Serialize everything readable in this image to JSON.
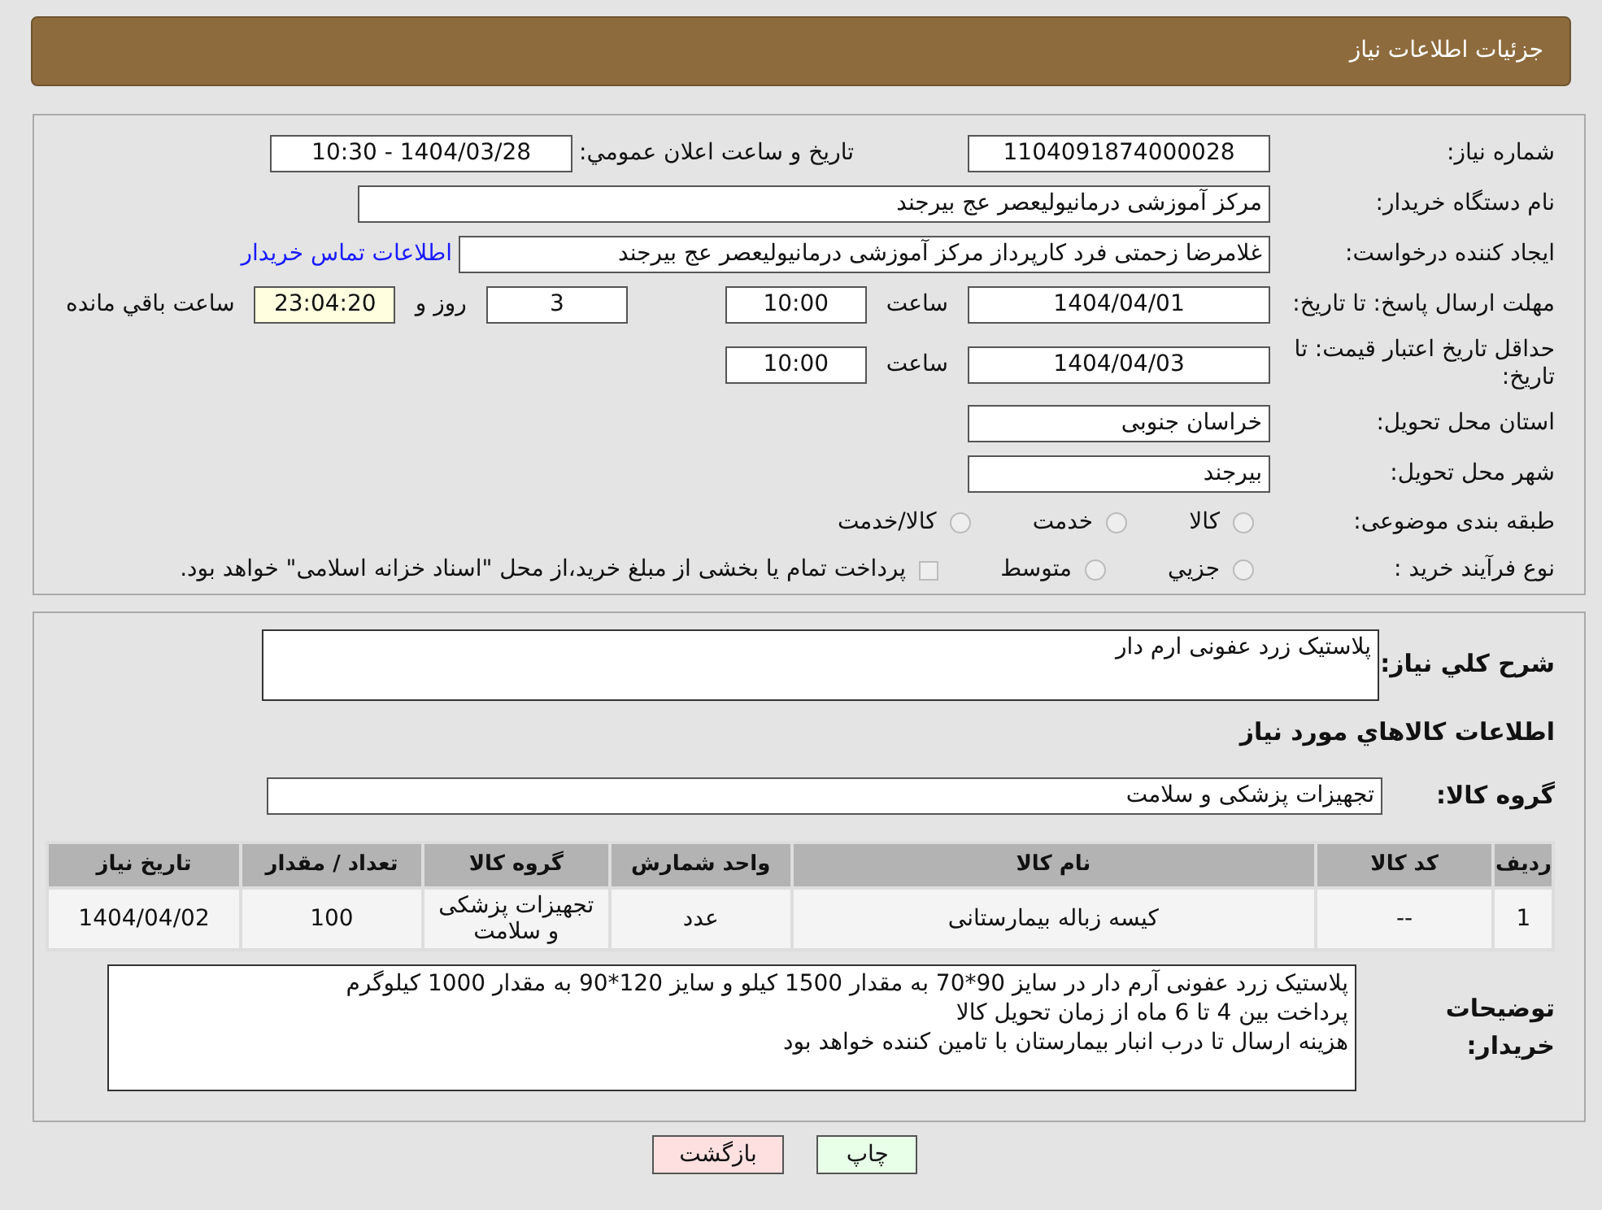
{
  "header": {
    "title": "جزئیات اطلاعات نیاز"
  },
  "need_number": {
    "label": "شماره نیاز:",
    "value": "1104091874000028"
  },
  "announce": {
    "label": "تاریخ و ساعت اعلان عمومي:",
    "value": "1404/03/28 - 10:30"
  },
  "buyer_org": {
    "label": "نام دستگاه خریدار:",
    "value": "مرکز آموزشی درمانیولیعصر  عج  بیرجند"
  },
  "requester": {
    "label": "ایجاد کننده درخواست:",
    "value": "غلامرضا زحمتی فرد کارپرداز مرکز آموزشی درمانیولیعصر  عج  بیرجند",
    "link": "اطلاعات تماس خریدار"
  },
  "reply_deadline": {
    "label": "مهلت ارسال پاسخ: تا تاریخ:",
    "date": "1404/04/01",
    "time_label": "ساعت",
    "time": "10:00",
    "days": "3",
    "days_label": "روز و",
    "remaining": "23:04:20",
    "remaining_label": "ساعت باقي مانده"
  },
  "price_validity": {
    "label": "حداقل تاریخ اعتبار قیمت: تا تاریخ:",
    "date": "1404/04/03",
    "time_label": "ساعت",
    "time": "10:00"
  },
  "province": {
    "label": "استان محل تحویل:",
    "value": "خراسان جنوبی"
  },
  "city": {
    "label": "شهر محل تحویل:",
    "value": "بیرجند"
  },
  "category": {
    "label": "طبقه بندی موضوعی:",
    "options": [
      {
        "label": "کالا",
        "selected": false
      },
      {
        "label": "خدمت",
        "selected": false
      },
      {
        "label": "کالا/خدمت",
        "selected": false
      }
    ]
  },
  "purchase_type": {
    "label": "نوع فرآیند خرید :",
    "options": [
      {
        "label": "جزيي",
        "selected": false
      },
      {
        "label": "متوسط",
        "selected": false
      }
    ],
    "note": {
      "text": "پرداخت تمام یا بخشی از مبلغ خرید،از محل \"اسناد خزانه اسلامی\" خواهد بود.",
      "checked": false
    }
  },
  "description": {
    "label": "شرح کلي نیاز:",
    "value": "پلاستیک زرد عفونی ارم دار"
  },
  "goods_heading": "اطلاعات کالاهاي مورد نیاز",
  "goods_group": {
    "label": "گروه کالا:",
    "value": "تجهیزات پزشکی و سلامت"
  },
  "table": {
    "columns": [
      "ردیف",
      "کد کالا",
      "نام کالا",
      "واحد شمارش",
      "گروه کالا",
      "تعداد / مقدار",
      "تاریخ نیاز"
    ],
    "rows": [
      [
        "1",
        "--",
        "کیسه زباله بیمارستانی",
        "عدد",
        "تجهیزات پزشکی و سلامت",
        "100",
        "1404/04/02"
      ]
    ]
  },
  "buyer_notes": {
    "label": "توضیحات خریدار:",
    "lines": [
      "پلاستیک زرد عفونی آرم دار در سایز 90*70 به مقدار 1500 کیلو و سایز 120*90 به مقدار 1000 کیلوگرم",
      "پرداخت بین 4 تا 6 ماه از زمان تحویل کالا",
      "هزینه ارسال تا درب انبار بیمارستان با تامین کننده خواهد بود"
    ]
  },
  "buttons": [
    {
      "kind": "print",
      "label": "چاپ"
    },
    {
      "kind": "back",
      "label": "بازگشت"
    }
  ]
}
